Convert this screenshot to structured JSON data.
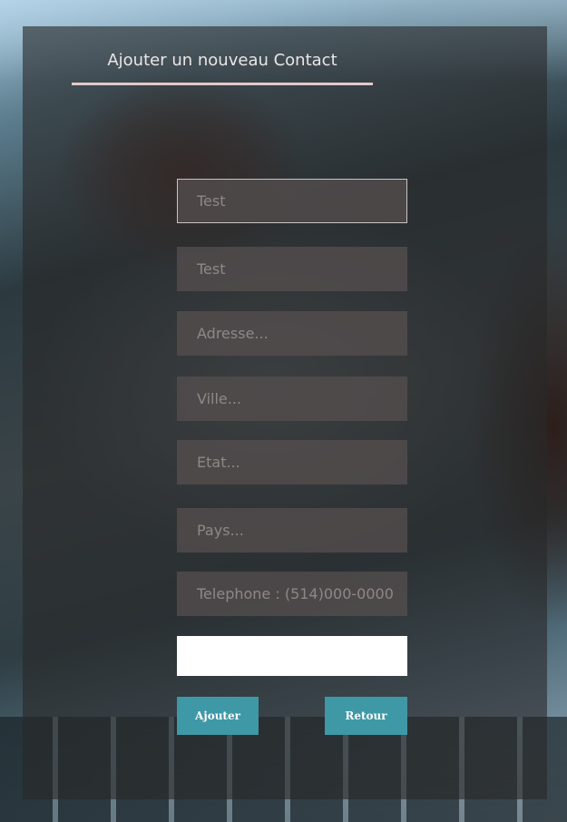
{
  "form": {
    "title": "Ajouter un nouveau Contact",
    "fields": [
      {
        "name": "nom",
        "value": "",
        "placeholder": "Test"
      },
      {
        "name": "prenom",
        "value": "",
        "placeholder": "Test"
      },
      {
        "name": "adresse",
        "value": "",
        "placeholder": "Adresse..."
      },
      {
        "name": "ville",
        "value": "",
        "placeholder": "Ville..."
      },
      {
        "name": "etat",
        "value": "",
        "placeholder": "Etat..."
      },
      {
        "name": "pays",
        "value": "",
        "placeholder": "Pays..."
      },
      {
        "name": "telephone",
        "value": "",
        "placeholder": "Telephone : (514)000-0000"
      },
      {
        "name": "extra",
        "value": "",
        "placeholder": ""
      }
    ],
    "buttons": {
      "add_label": "Ajouter",
      "back_label": "Retour"
    }
  },
  "colors": {
    "panel": "#282828",
    "accent_button": "#3f98a6",
    "title_underline": "#e2c9c9",
    "field_background": "#554e4e",
    "title_text": "#eae6e6"
  }
}
